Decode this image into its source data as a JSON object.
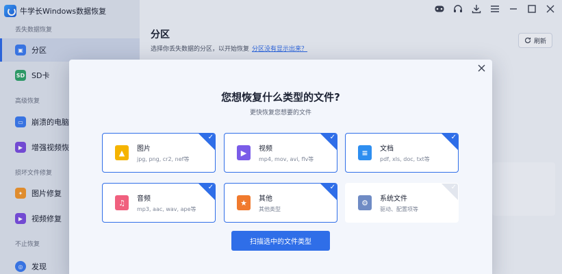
{
  "app": {
    "title": "牛学长Windows数据恢复"
  },
  "sidebar": {
    "sections": [
      {
        "label": "丢失数据恢复"
      },
      {
        "label": "高级恢复"
      },
      {
        "label": "损坏文件修复"
      },
      {
        "label": "不止恢复"
      }
    ],
    "items": [
      {
        "label": "分区",
        "icon": "partition-icon",
        "color": "#3b7bf0"
      },
      {
        "label": "SD卡",
        "icon": "sd-card-icon",
        "color": "#2fa36b"
      },
      {
        "label": "崩溃的电脑",
        "icon": "crashed-pc-icon",
        "color": "#3b7bf0"
      },
      {
        "label": "增强视频恢复",
        "icon": "video-enhance-icon",
        "color": "#7a4fe0"
      },
      {
        "label": "图片修复",
        "icon": "photo-repair-icon",
        "color": "#f0962e"
      },
      {
        "label": "视频修复",
        "icon": "video-repair-icon",
        "color": "#7a4fe0"
      },
      {
        "label": "发现",
        "icon": "discover-icon",
        "color": "#3b7bf0"
      }
    ]
  },
  "main": {
    "title": "分区",
    "subtitle": "选择你丢失数据的分区，以开始恢复",
    "help_link": "分区没有显示出来？",
    "refresh_label": "刷新"
  },
  "modal": {
    "title": "您想恢复什么类型的文件?",
    "subtitle": "更快恢复您想要的文件",
    "types": [
      {
        "name": "图片",
        "desc": "jpg, png, cr2, nef等",
        "icon": "image-icon",
        "color": "#f5b400",
        "checked": true
      },
      {
        "name": "视频",
        "desc": "mp4, mov, avi, flv等",
        "icon": "video-icon",
        "color": "#7a5ce8",
        "checked": true
      },
      {
        "name": "文档",
        "desc": "pdf, xls, doc, txt等",
        "icon": "document-icon",
        "color": "#2e8ef0",
        "checked": true
      },
      {
        "name": "音频",
        "desc": "mp3, aac, wav, ape等",
        "icon": "music-icon",
        "color": "#f0607e",
        "checked": true
      },
      {
        "name": "其他",
        "desc": "其他类型",
        "icon": "star-icon",
        "color": "#f07a2e",
        "checked": true
      },
      {
        "name": "系统文件",
        "desc": "驱动、配置项等",
        "icon": "system-gear-icon",
        "color": "#6f8bc4",
        "checked": false
      }
    ],
    "scan_label": "扫描选中的文件类型"
  },
  "colors": {
    "accent": "#2f6ee8"
  }
}
